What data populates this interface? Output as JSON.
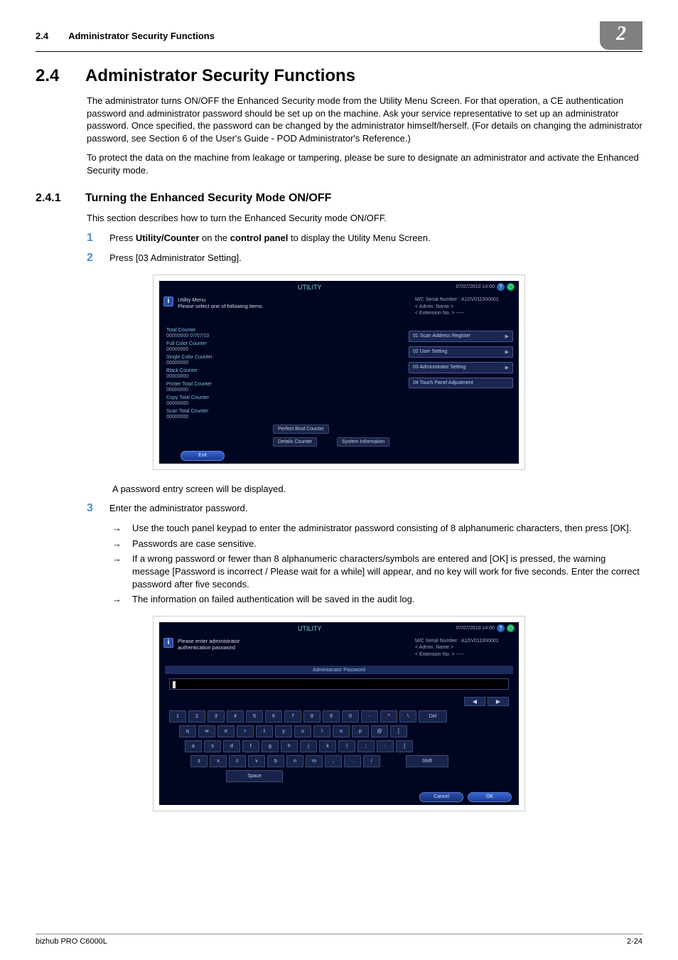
{
  "header": {
    "num": "2.4",
    "title": "Administrator Security Functions",
    "badge": "2"
  },
  "section": {
    "num": "2.4",
    "title": "Administrator Security Functions",
    "para1": "The administrator turns ON/OFF the Enhanced Security mode from the Utility Menu Screen. For that operation, a CE authentication password and administrator password should be set up on the machine. Ask your service representative to set up an administrator password. Once specified, the password can be changed by the administrator himself/herself. (For details on changing the administrator password, see Section 6 of the User's Guide - POD Administrator's Reference.)",
    "para2": "To protect the data on the machine from leakage or tampering, please be sure to designate an administrator and activate the Enhanced Security mode."
  },
  "subsection": {
    "num": "2.4.1",
    "title": "Turning the Enhanced Security Mode ON/OFF",
    "intro": "This section describes how to turn the Enhanced Security mode ON/OFF."
  },
  "steps": {
    "s1": {
      "num": "1",
      "text_pre": "Press ",
      "b1": "Utility/Counter",
      "mid": " on the ",
      "b2": "control panel",
      "text_post": " to display the Utility Menu Screen."
    },
    "s2": {
      "num": "2",
      "text": "Press [03 Administrator Setting]."
    },
    "after_shot1": "A password entry screen will be displayed.",
    "s3": {
      "num": "3",
      "text": "Enter the administrator password."
    },
    "s3_b1": "Use the touch panel keypad to enter the administrator password consisting of 8 alphanumeric characters, then press [OK].",
    "s3_b2": "Passwords are case sensitive.",
    "s3_b3": "If a wrong password or fewer than 8 alphanumeric characters/symbols are entered and [OK] is pressed, the warning message [Password is incorrect / Please wait for a while] will appear, and no key will work for five seconds. Enter the correct password after five seconds.",
    "s3_b4": "The information on failed authentication will be saved in the audit log."
  },
  "shot1": {
    "topbar_center": "UTILITY",
    "topbar_date": "07/07/2010 14:00",
    "header_l1": "Utility Menu",
    "header_l2": "Please select one of following items",
    "header_r1": "M/C Serial Number : A1DV011000001",
    "header_r2": "< Admin. Name >",
    "header_r3": "< Extension No. > -----",
    "counters": [
      {
        "label": "Total Counter",
        "val": "00000000  07/07/10"
      },
      {
        "label": "Full Color Counter",
        "val": "00000000"
      },
      {
        "label": "Single Color Counter",
        "val": "00000000"
      },
      {
        "label": "Black Counter",
        "val": "00000000"
      },
      {
        "label": "Printer Total Counter",
        "val": "00000000"
      },
      {
        "label": "Copy Total Counter",
        "val": "00000000"
      },
      {
        "label": "Scan Total Counter",
        "val": "00000000"
      }
    ],
    "mid_btn1": "Perfect Bind Counter",
    "mid_btn2": "Details Counter",
    "mid_btn3": "System Information",
    "right_buttons": [
      "01 Scan Address Register",
      "02 User Setting",
      "03 Administrator Setting",
      "04 Touch Panel Adjustment"
    ],
    "exit": "Exit"
  },
  "shot2": {
    "topbar_center": "UTILITY",
    "topbar_date": "07/07/2010 14:00",
    "header_l1": "Please enter administrator",
    "header_l2": "authentication password",
    "header_r1": "M/C Serial Number : A1DV011000001",
    "header_r2": "< Admin. Name >",
    "header_r3": "< Extension No. > -----",
    "banner": "Administrator Password",
    "row1": [
      "1",
      "2",
      "3",
      "4",
      "5",
      "6",
      "7",
      "8",
      "9",
      "0",
      "-",
      "^",
      "\\"
    ],
    "del": "Del",
    "row2": [
      "q",
      "w",
      "e",
      "r",
      "t",
      "y",
      "u",
      "i",
      "o",
      "p",
      "@",
      "["
    ],
    "row3": [
      "a",
      "s",
      "d",
      "f",
      "g",
      "h",
      "j",
      "k",
      "l",
      ";",
      ":",
      "]"
    ],
    "row4": [
      "z",
      "x",
      "c",
      "v",
      "b",
      "n",
      "m",
      ",",
      ".",
      "/"
    ],
    "shift": "Shift",
    "space": "Space",
    "cancel": "Cancel",
    "ok": "OK"
  },
  "footer": {
    "left": "bizhub PRO C6000L",
    "right": "2-24"
  }
}
